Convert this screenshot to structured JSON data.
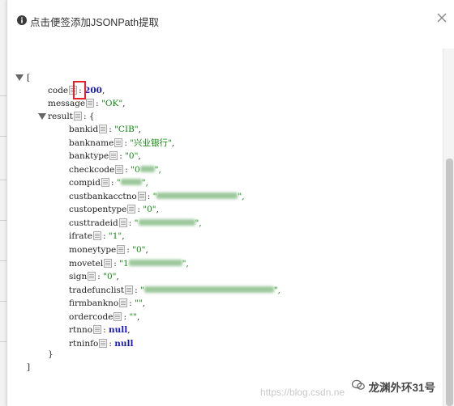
{
  "dialog": {
    "title": "点击便签添加JSONPath提取",
    "close_symbol": "×"
  },
  "json": {
    "open_bracket": "[",
    "close_bracket": "]",
    "open_brace": "{",
    "close_brace": "}",
    "code": {
      "key": "code",
      "value": "200"
    },
    "message": {
      "key": "message",
      "value": "\"OK\""
    },
    "result_key": "result",
    "fields": [
      {
        "key": "bankid",
        "value": "\"CIB\""
      },
      {
        "key": "bankname",
        "value": "\"兴业银行\""
      },
      {
        "key": "banktype",
        "value": "\"0\""
      },
      {
        "key": "checkcode",
        "value": "\"0"
      },
      {
        "key": "compid",
        "value": "\""
      },
      {
        "key": "custbankacctno",
        "value": "\""
      },
      {
        "key": "custopentype",
        "value": "\"0\""
      },
      {
        "key": "custtradeid",
        "value": "\""
      },
      {
        "key": "ifrate",
        "value": "\"1\""
      },
      {
        "key": "moneytype",
        "value": "\"0\""
      },
      {
        "key": "movetel",
        "value": "\"1"
      },
      {
        "key": "sign",
        "value": "\"0\""
      },
      {
        "key": "tradefunclist",
        "value": "\""
      },
      {
        "key": "firmbankno",
        "value": "\"\""
      },
      {
        "key": "ordercode",
        "value": "\"\""
      },
      {
        "key": "rtnno",
        "value": "null"
      },
      {
        "key": "rtninfo",
        "value": "null"
      }
    ]
  },
  "watermark": {
    "account": "龙渊外环31号",
    "blog_url": "https://blog.csdn.ne"
  },
  "colors": {
    "highlight": "#e0242a",
    "string": "#118811",
    "number": "#1a1ab4"
  }
}
